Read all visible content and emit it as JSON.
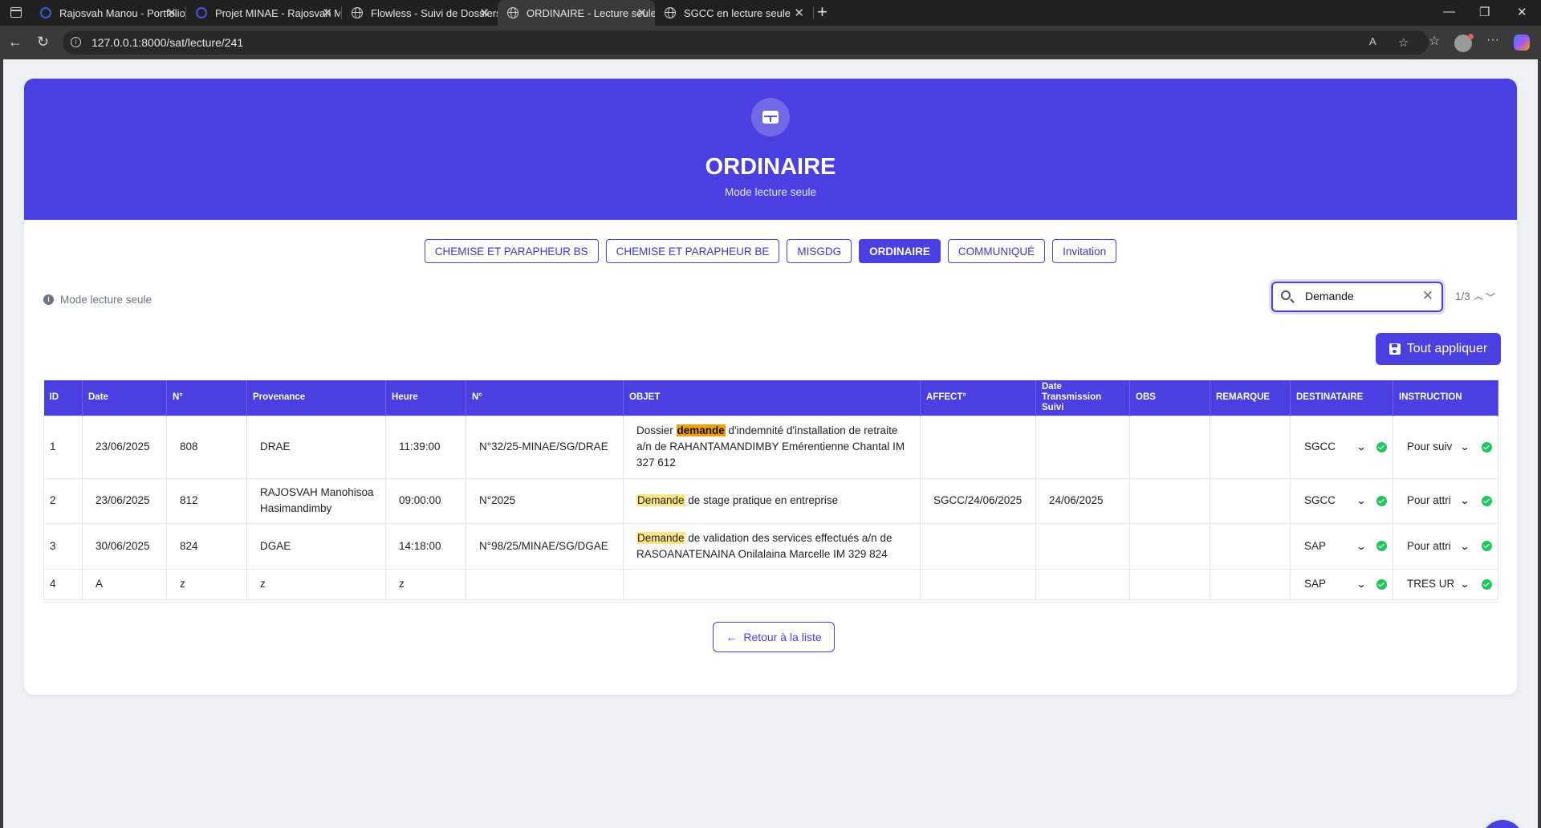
{
  "browser": {
    "tabs": [
      {
        "title": "Rajosvah Manou - Portfolio",
        "icon": "circle-favicon-icon"
      },
      {
        "title": "Projet MINAE - Rajosvah Manou",
        "icon": "circle-favicon-icon"
      },
      {
        "title": "Flowless - Suivi de Dossiers - MIN",
        "icon": "globe-icon"
      },
      {
        "title": "ORDINAIRE - Lecture seule",
        "icon": "globe-icon"
      },
      {
        "title": "SGCC en lecture seule",
        "icon": "globe-icon"
      }
    ],
    "active_tab": 3,
    "url": "127.0.0.1:8000/sat/lecture/241"
  },
  "header": {
    "title": "ORDINAIRE",
    "subtitle": "Mode lecture seule",
    "icon": "table-icon"
  },
  "category_tabs": [
    {
      "label": "CHEMISE ET PARAPHEUR BS",
      "selected": false
    },
    {
      "label": "CHEMISE ET PARAPHEUR BE",
      "selected": false
    },
    {
      "label": "MISGDG",
      "selected": false
    },
    {
      "label": "ORDINAIRE",
      "selected": true
    },
    {
      "label": "COMMUNIQUÉ",
      "selected": false
    },
    {
      "label": "Invitation",
      "selected": false
    }
  ],
  "readonly_note": "Mode lecture seule",
  "search": {
    "value": "Demande",
    "match_counter": "1/3"
  },
  "apply_button": "Tout appliquer",
  "table": {
    "columns": [
      "ID",
      "Date",
      "N°",
      "Provenance",
      "Heure",
      "N°",
      "OBJET",
      "AFFECT°",
      "Date Transmission Suivi",
      "OBS",
      "REMARQUE",
      "DESTINATAIRE",
      "INSTRUCTION"
    ],
    "rows": [
      {
        "id": "1",
        "date": "23/06/2025",
        "num": "808",
        "provenance": "DRAE",
        "heure": "11:39:00",
        "ref": "N°32/25-MINAE/SG/DRAE",
        "objet_pre": "Dossier ",
        "objet_match": "demande",
        "objet_post": " d'indemnité d'installation de retraite a/n de RAHANTAMANDIMBY Emérentienne Chantal IM 327 612",
        "current_match": true,
        "affect": "",
        "date_transmission": "",
        "obs": "",
        "remarque": "",
        "destinataire": "SGCC",
        "instruction": "Pour suiv"
      },
      {
        "id": "2",
        "date": "23/06/2025",
        "num": "812",
        "provenance": "RAJOSVAH Manohisoa Hasimandimby",
        "heure": "09:00:00",
        "ref": "N°2025",
        "objet_pre": "",
        "objet_match": "Demande",
        "objet_post": " de stage pratique en entreprise",
        "current_match": false,
        "affect": "SGCC/24/06/2025",
        "date_transmission": "24/06/2025",
        "obs": "",
        "remarque": "",
        "destinataire": "SGCC",
        "instruction": "Pour attri"
      },
      {
        "id": "3",
        "date": "30/06/2025",
        "num": "824",
        "provenance": "DGAE",
        "heure": "14:18:00",
        "ref": "N°98/25/MINAE/SG/DGAE",
        "objet_pre": "",
        "objet_match": "Demande",
        "objet_post": " de validation des services effectués a/n de RASOANATENAINA Onilalaina Marcelle IM 329 824",
        "current_match": false,
        "affect": "",
        "date_transmission": "",
        "obs": "",
        "remarque": "",
        "destinataire": "SAP",
        "instruction": "Pour attri"
      },
      {
        "id": "4",
        "date": "A",
        "num": "z",
        "provenance": "z",
        "heure": "z",
        "ref": "",
        "objet_pre": "",
        "objet_match": "",
        "objet_post": "",
        "current_match": false,
        "affect": "",
        "date_transmission": "",
        "obs": "",
        "remarque": "",
        "destinataire": "SAP",
        "instruction": "TRES URG"
      }
    ]
  },
  "back_button": "Retour à la liste",
  "colors": {
    "primary": "#4a3fe0",
    "highlight": "#fde68a",
    "current_highlight": "#f59e0b",
    "success": "#22c55e"
  }
}
